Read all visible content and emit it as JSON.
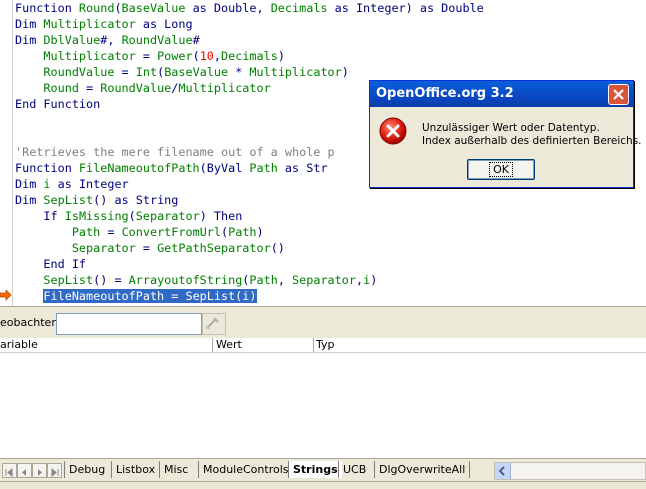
{
  "editor": {
    "lines": [
      [
        [
          "kw",
          "Function "
        ],
        [
          "id",
          "Round"
        ],
        [
          "op",
          "("
        ],
        [
          "id",
          "BaseValue"
        ],
        [
          "kw",
          " as Double, "
        ],
        [
          "id",
          "Decimals"
        ],
        [
          "kw",
          " as Integer) as Double"
        ]
      ],
      [
        [
          "kw",
          "Dim "
        ],
        [
          "id",
          "Multiplicator"
        ],
        [
          "kw",
          " as Long"
        ]
      ],
      [
        [
          "kw",
          "Dim "
        ],
        [
          "id",
          "DblValue"
        ],
        [
          "kw",
          "#, "
        ],
        [
          "id",
          "RoundValue"
        ],
        [
          "kw",
          "#"
        ]
      ],
      [
        [
          "plain",
          "    "
        ],
        [
          "id",
          "Multiplicator"
        ],
        [
          "op",
          " = "
        ],
        [
          "id",
          "Power"
        ],
        [
          "op",
          "("
        ],
        [
          "num",
          "10"
        ],
        [
          "op",
          ","
        ],
        [
          "id",
          "Decimals"
        ],
        [
          "op",
          ")"
        ]
      ],
      [
        [
          "plain",
          "    "
        ],
        [
          "id",
          "RoundValue"
        ],
        [
          "op",
          " = "
        ],
        [
          "id",
          "Int"
        ],
        [
          "op",
          "("
        ],
        [
          "id",
          "BaseValue"
        ],
        [
          "op",
          " * "
        ],
        [
          "id",
          "Multiplicator"
        ],
        [
          "op",
          ")"
        ]
      ],
      [
        [
          "plain",
          "    "
        ],
        [
          "id",
          "Round"
        ],
        [
          "op",
          " = "
        ],
        [
          "id",
          "RoundValue"
        ],
        [
          "op",
          "/"
        ],
        [
          "id",
          "Multiplicator"
        ]
      ],
      [
        [
          "kw",
          "End Function"
        ]
      ],
      [],
      [],
      [
        [
          "cmt",
          "'Retrieves the mere filename out of a whole p"
        ]
      ],
      [
        [
          "kw",
          "Function "
        ],
        [
          "id",
          "FileNameoutofPath"
        ],
        [
          "op",
          "("
        ],
        [
          "kw",
          "ByVal "
        ],
        [
          "id",
          "Path"
        ],
        [
          "kw",
          " as Str"
        ]
      ],
      [
        [
          "kw",
          "Dim "
        ],
        [
          "id",
          "i"
        ],
        [
          "kw",
          " as Integer"
        ]
      ],
      [
        [
          "kw",
          "Dim "
        ],
        [
          "id",
          "SepList"
        ],
        [
          "op",
          "()"
        ],
        [
          "kw",
          " as String"
        ]
      ],
      [
        [
          "plain",
          "    "
        ],
        [
          "kw",
          "If "
        ],
        [
          "id",
          "IsMissing"
        ],
        [
          "op",
          "("
        ],
        [
          "id",
          "Separator"
        ],
        [
          "op",
          ")"
        ],
        [
          "kw",
          " Then"
        ]
      ],
      [
        [
          "plain",
          "        "
        ],
        [
          "id",
          "Path"
        ],
        [
          "op",
          " = "
        ],
        [
          "id",
          "ConvertFromUrl"
        ],
        [
          "op",
          "("
        ],
        [
          "id",
          "Path"
        ],
        [
          "op",
          ")"
        ]
      ],
      [
        [
          "plain",
          "        "
        ],
        [
          "id",
          "Separator"
        ],
        [
          "op",
          " = "
        ],
        [
          "id",
          "GetPathSeparator"
        ],
        [
          "op",
          "()"
        ]
      ],
      [
        [
          "plain",
          "    "
        ],
        [
          "kw",
          "End If"
        ]
      ],
      [
        [
          "plain",
          "    "
        ],
        [
          "id",
          "SepList"
        ],
        [
          "op",
          "() = "
        ],
        [
          "id",
          "ArrayoutofString"
        ],
        [
          "op",
          "("
        ],
        [
          "id",
          "Path"
        ],
        [
          "op",
          ", "
        ],
        [
          "id",
          "Separator"
        ],
        [
          "op",
          ","
        ],
        [
          "id",
          "i"
        ],
        [
          "op",
          ")"
        ]
      ],
      [
        [
          "plain",
          "    "
        ],
        [
          "sel",
          "FileNameoutofPath = SepList(i)"
        ]
      ]
    ]
  },
  "watch": {
    "label": "eobachter:",
    "input_value": "",
    "columns": [
      "ariable",
      "Wert",
      "Typ"
    ]
  },
  "tabs": {
    "items": [
      "Debug",
      "Listbox",
      "Misc",
      "ModuleControls",
      "Strings",
      "UCB",
      "DlgOverwriteAll"
    ],
    "active": "Strings"
  },
  "dialog": {
    "title": "OpenOffice.org 3.2",
    "message_line1": "Unzulässiger Wert oder Datentyp.",
    "message_line2": "Index außerhalb des definierten Bereichs.",
    "ok_label": "OK",
    "icon": "error-icon"
  },
  "colors": {
    "keyword": "#000080",
    "identifier": "#008000",
    "number": "#ff0000",
    "comment": "#808080",
    "selection": "#316ac5",
    "titlebar": "#0a5fd8",
    "close_button": "#d8543a"
  }
}
